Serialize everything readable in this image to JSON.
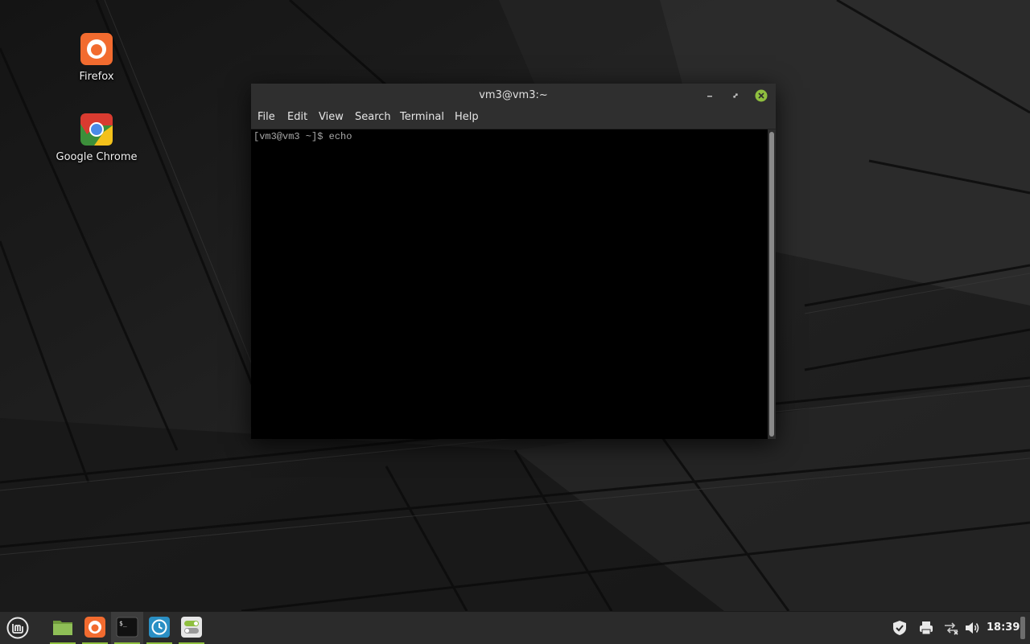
{
  "desktop": {
    "icons": [
      {
        "label": "Firefox",
        "icon": "firefox-icon"
      },
      {
        "label": "Google Chrome",
        "icon": "chrome-icon"
      }
    ]
  },
  "terminal": {
    "title": "vm3@vm3:~",
    "menu": [
      "File",
      "Edit",
      "View",
      "Search",
      "Terminal",
      "Help"
    ],
    "lines": [
      "[vm3@vm3 ~]$ echo"
    ],
    "buttons": {
      "minimize": "minimize-icon",
      "maximize": "maximize-icon",
      "close": "close-icon"
    }
  },
  "panel": {
    "launchers": [
      {
        "name": "menu",
        "icon": "linux-mint-logo-icon"
      },
      {
        "name": "files",
        "icon": "folder-icon"
      },
      {
        "name": "firefox",
        "icon": "firefox-icon"
      },
      {
        "name": "terminal",
        "icon": "terminal-icon",
        "state": "active"
      },
      {
        "name": "timeshift",
        "icon": "clock-icon"
      },
      {
        "name": "settings",
        "icon": "toggle-settings-icon"
      }
    ],
    "tray": [
      "shield-icon",
      "printer-icon",
      "network-disconnected-icon",
      "volume-icon"
    ],
    "clock": "18:39"
  },
  "colors": {
    "accent_green": "#8fbf3f",
    "close_button": "#8fbf3f",
    "firefox_orange": "#f26b2f",
    "panel_bg": "#2b2b2b",
    "terminal_bg": "#000000"
  }
}
